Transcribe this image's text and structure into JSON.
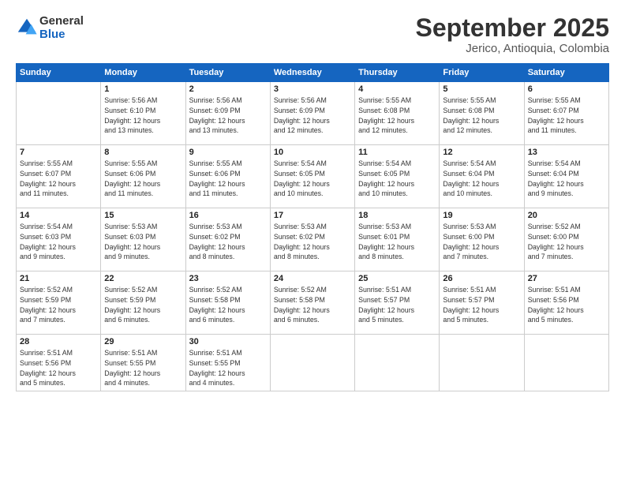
{
  "header": {
    "logo_line1": "General",
    "logo_line2": "Blue",
    "title": "September 2025",
    "subtitle": "Jerico, Antioquia, Colombia"
  },
  "calendar": {
    "days_of_week": [
      "Sunday",
      "Monday",
      "Tuesday",
      "Wednesday",
      "Thursday",
      "Friday",
      "Saturday"
    ],
    "weeks": [
      [
        {
          "date": "",
          "info": ""
        },
        {
          "date": "1",
          "info": "Sunrise: 5:56 AM\nSunset: 6:10 PM\nDaylight: 12 hours\nand 13 minutes."
        },
        {
          "date": "2",
          "info": "Sunrise: 5:56 AM\nSunset: 6:09 PM\nDaylight: 12 hours\nand 13 minutes."
        },
        {
          "date": "3",
          "info": "Sunrise: 5:56 AM\nSunset: 6:09 PM\nDaylight: 12 hours\nand 12 minutes."
        },
        {
          "date": "4",
          "info": "Sunrise: 5:55 AM\nSunset: 6:08 PM\nDaylight: 12 hours\nand 12 minutes."
        },
        {
          "date": "5",
          "info": "Sunrise: 5:55 AM\nSunset: 6:08 PM\nDaylight: 12 hours\nand 12 minutes."
        },
        {
          "date": "6",
          "info": "Sunrise: 5:55 AM\nSunset: 6:07 PM\nDaylight: 12 hours\nand 11 minutes."
        }
      ],
      [
        {
          "date": "7",
          "info": "Sunrise: 5:55 AM\nSunset: 6:07 PM\nDaylight: 12 hours\nand 11 minutes."
        },
        {
          "date": "8",
          "info": "Sunrise: 5:55 AM\nSunset: 6:06 PM\nDaylight: 12 hours\nand 11 minutes."
        },
        {
          "date": "9",
          "info": "Sunrise: 5:55 AM\nSunset: 6:06 PM\nDaylight: 12 hours\nand 11 minutes."
        },
        {
          "date": "10",
          "info": "Sunrise: 5:54 AM\nSunset: 6:05 PM\nDaylight: 12 hours\nand 10 minutes."
        },
        {
          "date": "11",
          "info": "Sunrise: 5:54 AM\nSunset: 6:05 PM\nDaylight: 12 hours\nand 10 minutes."
        },
        {
          "date": "12",
          "info": "Sunrise: 5:54 AM\nSunset: 6:04 PM\nDaylight: 12 hours\nand 10 minutes."
        },
        {
          "date": "13",
          "info": "Sunrise: 5:54 AM\nSunset: 6:04 PM\nDaylight: 12 hours\nand 9 minutes."
        }
      ],
      [
        {
          "date": "14",
          "info": "Sunrise: 5:54 AM\nSunset: 6:03 PM\nDaylight: 12 hours\nand 9 minutes."
        },
        {
          "date": "15",
          "info": "Sunrise: 5:53 AM\nSunset: 6:03 PM\nDaylight: 12 hours\nand 9 minutes."
        },
        {
          "date": "16",
          "info": "Sunrise: 5:53 AM\nSunset: 6:02 PM\nDaylight: 12 hours\nand 8 minutes."
        },
        {
          "date": "17",
          "info": "Sunrise: 5:53 AM\nSunset: 6:02 PM\nDaylight: 12 hours\nand 8 minutes."
        },
        {
          "date": "18",
          "info": "Sunrise: 5:53 AM\nSunset: 6:01 PM\nDaylight: 12 hours\nand 8 minutes."
        },
        {
          "date": "19",
          "info": "Sunrise: 5:53 AM\nSunset: 6:00 PM\nDaylight: 12 hours\nand 7 minutes."
        },
        {
          "date": "20",
          "info": "Sunrise: 5:52 AM\nSunset: 6:00 PM\nDaylight: 12 hours\nand 7 minutes."
        }
      ],
      [
        {
          "date": "21",
          "info": "Sunrise: 5:52 AM\nSunset: 5:59 PM\nDaylight: 12 hours\nand 7 minutes."
        },
        {
          "date": "22",
          "info": "Sunrise: 5:52 AM\nSunset: 5:59 PM\nDaylight: 12 hours\nand 6 minutes."
        },
        {
          "date": "23",
          "info": "Sunrise: 5:52 AM\nSunset: 5:58 PM\nDaylight: 12 hours\nand 6 minutes."
        },
        {
          "date": "24",
          "info": "Sunrise: 5:52 AM\nSunset: 5:58 PM\nDaylight: 12 hours\nand 6 minutes."
        },
        {
          "date": "25",
          "info": "Sunrise: 5:51 AM\nSunset: 5:57 PM\nDaylight: 12 hours\nand 5 minutes."
        },
        {
          "date": "26",
          "info": "Sunrise: 5:51 AM\nSunset: 5:57 PM\nDaylight: 12 hours\nand 5 minutes."
        },
        {
          "date": "27",
          "info": "Sunrise: 5:51 AM\nSunset: 5:56 PM\nDaylight: 12 hours\nand 5 minutes."
        }
      ],
      [
        {
          "date": "28",
          "info": "Sunrise: 5:51 AM\nSunset: 5:56 PM\nDaylight: 12 hours\nand 5 minutes."
        },
        {
          "date": "29",
          "info": "Sunrise: 5:51 AM\nSunset: 5:55 PM\nDaylight: 12 hours\nand 4 minutes."
        },
        {
          "date": "30",
          "info": "Sunrise: 5:51 AM\nSunset: 5:55 PM\nDaylight: 12 hours\nand 4 minutes."
        },
        {
          "date": "",
          "info": ""
        },
        {
          "date": "",
          "info": ""
        },
        {
          "date": "",
          "info": ""
        },
        {
          "date": "",
          "info": ""
        }
      ]
    ]
  }
}
